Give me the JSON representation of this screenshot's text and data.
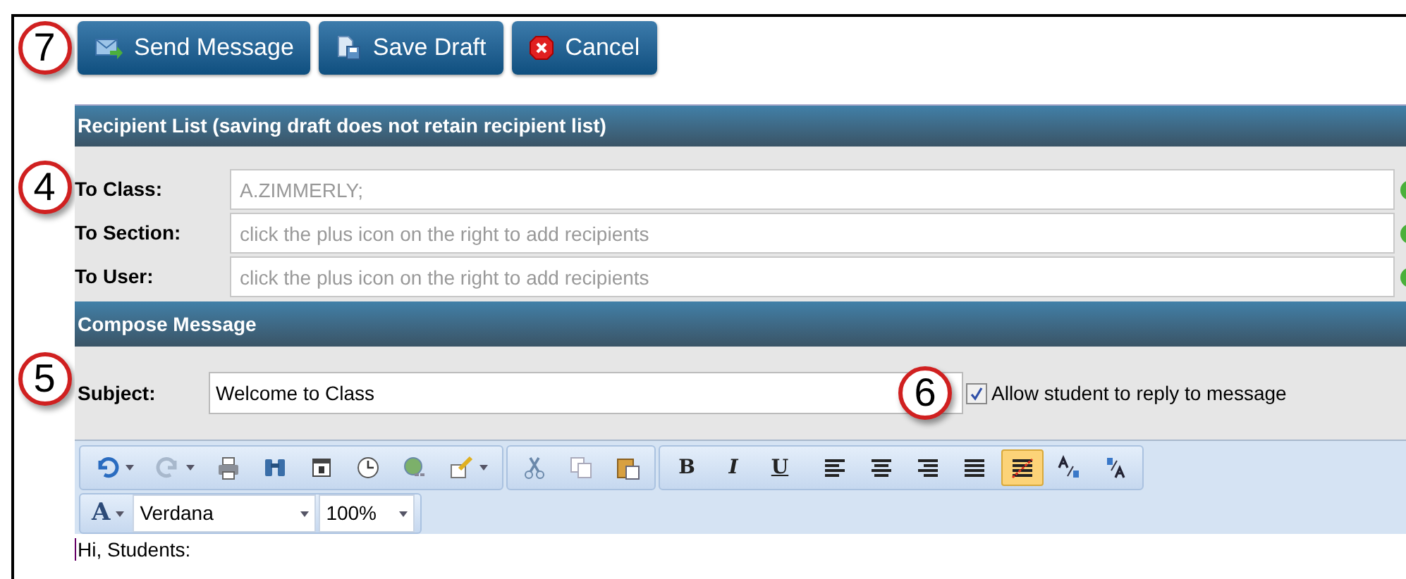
{
  "callouts": [
    "7",
    "4",
    "5",
    "6"
  ],
  "actions": [
    {
      "kind": "send",
      "label": "Send Message"
    },
    {
      "kind": "draft",
      "label": "Save Draft"
    },
    {
      "kind": "cancel",
      "label": "Cancel"
    }
  ],
  "recipients": {
    "title": "Recipient List (saving draft does not retain recipient list)",
    "rows": [
      {
        "label": "To Class:",
        "value": "A.ZIMMERLY;"
      },
      {
        "label": "To Section:",
        "placeholder": "click the plus icon on the right to add recipients"
      },
      {
        "label": "To User:",
        "placeholder": "click the plus icon on the right to add recipients"
      }
    ]
  },
  "compose": {
    "title": "Compose Message",
    "subject_label": "Subject:",
    "subject": "Welcome to Class",
    "allow_reply": {
      "label": "Allow student to reply to message",
      "checked": true
    }
  },
  "editor": {
    "tools": [
      {
        "kind": "undo",
        "selected": false
      },
      {
        "kind": "redo",
        "selected": false
      },
      {
        "kind": "print",
        "selected": false
      },
      {
        "kind": "find",
        "selected": false
      },
      {
        "kind": "calendar",
        "selected": false
      },
      {
        "kind": "clock",
        "selected": false
      },
      {
        "kind": "link",
        "selected": false
      },
      {
        "kind": "brush",
        "selected": false
      },
      {
        "kind": "cut",
        "selected": false
      },
      {
        "kind": "copy",
        "selected": false
      },
      {
        "kind": "paste",
        "selected": false
      },
      {
        "kind": "text",
        "label": "B",
        "selected": false
      },
      {
        "kind": "text",
        "label": "I",
        "selected": false
      },
      {
        "kind": "text",
        "label": "U",
        "selected": false
      },
      {
        "kind": "align-left",
        "selected": false
      },
      {
        "kind": "align-center",
        "selected": false
      },
      {
        "kind": "align-right",
        "selected": false
      },
      {
        "kind": "justify",
        "selected": false
      },
      {
        "kind": "strike",
        "selected": true
      },
      {
        "kind": "subscript",
        "selected": false
      },
      {
        "kind": "superscript",
        "selected": false
      }
    ],
    "font_color_label": "A",
    "font": "Verdana",
    "size": "100%",
    "body": "Hi, Students:"
  }
}
